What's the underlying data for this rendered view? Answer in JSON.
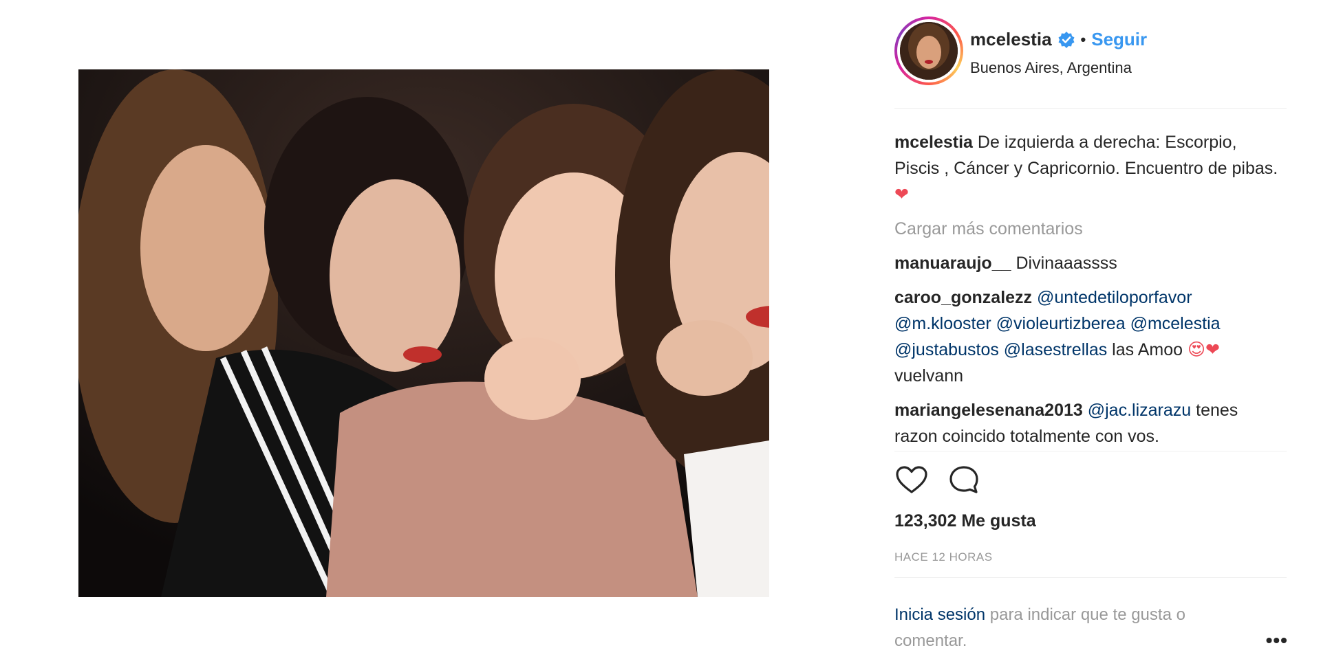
{
  "post": {
    "photo_alt": "photo",
    "username": "mcelestia",
    "follow_label": "Seguir",
    "separator": "•",
    "location": "Buenos Aires, Argentina"
  },
  "caption": {
    "username": "mcelestia",
    "text": " De izquierda a derecha: Escorpio, Piscis , Cáncer y Capricornio. Encuentro de pibas. ",
    "emoji": "❤"
  },
  "comments": {
    "load_more": "Cargar más comentarios",
    "items": [
      {
        "username": "manuaraujo__",
        "text": " Divinaaassss"
      },
      {
        "username": "caroo_gonzalezz",
        "mentions": [
          "@untedetiloporfavor",
          "@m.klooster",
          "@violeurtizberea",
          "@mcelestia",
          "@justabustos",
          "@lasestrellas"
        ],
        "text": " las Amoo ",
        "emoji": "😍❤",
        "tail": " vuelvann"
      },
      {
        "username": "mariangelesenana2013",
        "mention": "@jac.lizarazu",
        "text": " tenes razon coincido totalmente con vos."
      }
    ]
  },
  "actions": {
    "like_icon": "heart-outline-icon",
    "comment_icon": "comment-bubble-icon"
  },
  "likes": {
    "count": "123,302",
    "label": "Me gusta"
  },
  "timestamp": "HACE 12 HORAS",
  "login_prompt": {
    "link": "Inicia sesión",
    "text": " para indicar que te gusta o comentar."
  },
  "more_options": "•••",
  "colors": {
    "link_blue": "#3897f0",
    "mention": "#003569",
    "muted": "#999999",
    "heart": "#ed4956",
    "verified": "#3897f0"
  }
}
